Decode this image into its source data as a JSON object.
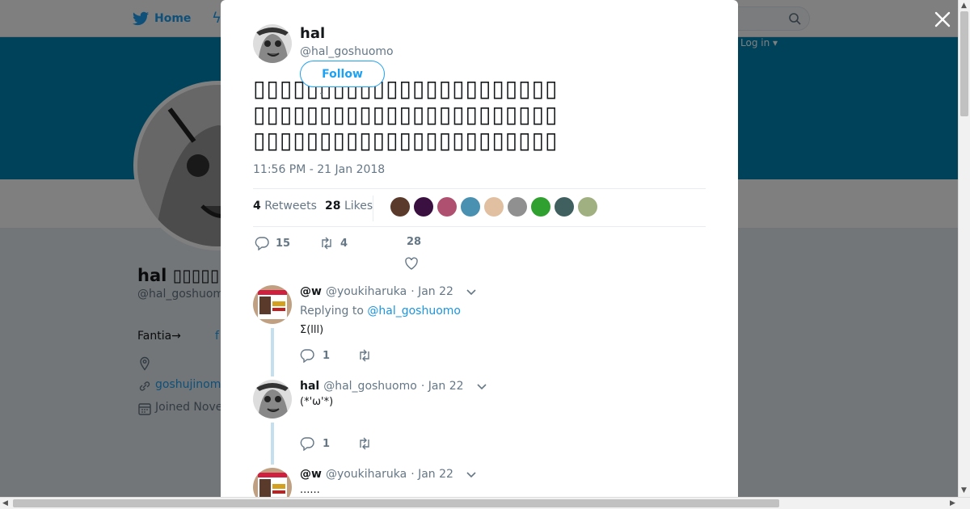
{
  "nav": {
    "home_label": "Home",
    "login_label": "Log in ▾"
  },
  "profile": {
    "name": "hal",
    "name_suffix": "▯▯▯▯▯",
    "handle": "@hal_goshuomo",
    "bio_prefix": "Fantia→",
    "bio_link": "f",
    "url": "goshujinom",
    "joined": "Joined Nove"
  },
  "tweet": {
    "author_name": "hal",
    "author_handle": "@hal_goshuomo",
    "follow_label": "Follow",
    "text": "▯▯▯▯▯▯▯▯▯▯▯▯▯▯▯▯▯▯▯▯▯▯▯▯▯▯▯▯▯▯▯▯▯▯▯▯▯▯▯▯▯▯▯▯▯▯▯▯▯▯▯▯▯▯▯▯▯▯▯▯▯▯▯▯▯▯▯▯▯",
    "timestamp": "11:56 PM - 21 Jan 2018",
    "retweets_count": "4",
    "retweets_label": "Retweets",
    "likes_count": "28",
    "likes_label": "Likes",
    "reply_count": "15",
    "retweet_count": "4",
    "like_count": "28"
  },
  "likers": [
    "#5a3a2a",
    "#3a1040",
    "#b05070",
    "#4a90b0",
    "#e0c0a0",
    "#909090",
    "#30a030",
    "#406060",
    "#a0b080"
  ],
  "replies": [
    {
      "name": "@w",
      "handle": "@youkiharuka",
      "date": "· Jan 22",
      "replying_label": "Replying to",
      "replying_to": "@hal_goshuomo",
      "text": "Σ(lll)",
      "reply_count": "1"
    },
    {
      "name": "hal",
      "handle": "@hal_goshuomo",
      "date": "· Jan 22",
      "text": "(*'ω'*)",
      "reply_count": "1"
    },
    {
      "name": "@w",
      "handle": "@youkiharuka",
      "date": "· Jan 22",
      "text": "......"
    }
  ]
}
